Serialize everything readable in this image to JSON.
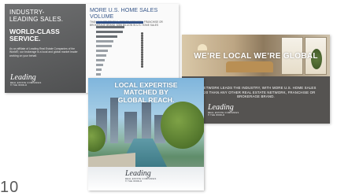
{
  "card1": {
    "industry": "INDUSTRY-\nLEADING SALES.",
    "world_class": "WORLD-CLASS\nSERVICE.",
    "body": "As an affiliate of Leading Real Estate Companies of the World®, our brokerage is a local and global market leader working on your behalf.",
    "logo_word": "Leading",
    "logo_sub": "REAL ESTATE COMPANIES\n® THE WORLD",
    "chart_title": "MORE U.S. HOME SALES VOLUME",
    "chart_sub": "THAN ANY OTHER REAL ESTATE NETWORK, FRANCHISE OR BROKERAGE BRAND. $396 BILLION IN U.S. HOME SALES"
  },
  "card2": {
    "headline": "WE’RE LOCAL WE’RE GLOBAL",
    "body": "AL NETWORK LEADS THE INDUSTRY, WITH MORE U.S. HOME SALES\nS 2020 THAN ANY OTHER REAL ESTATE NETWORK, FRANCHISE OR\nBROKERAGE BRAND.",
    "logo_word": "Leading",
    "logo_sub": "REAL ESTATE COMPANIES\n® THE WORLD"
  },
  "card3": {
    "headline": "LOCAL EXPERTISE\nMATCHED BY\nGLOBAL REACH.",
    "logo_word": "Leading",
    "logo_sub": "REAL ESTATE COMPANIES\n® THE WORLD"
  },
  "partial_text": "10",
  "colors": {
    "chart_lead": "#2f4f86",
    "chart_title": "#3b5a8c",
    "panel_grey": "#555351"
  }
}
